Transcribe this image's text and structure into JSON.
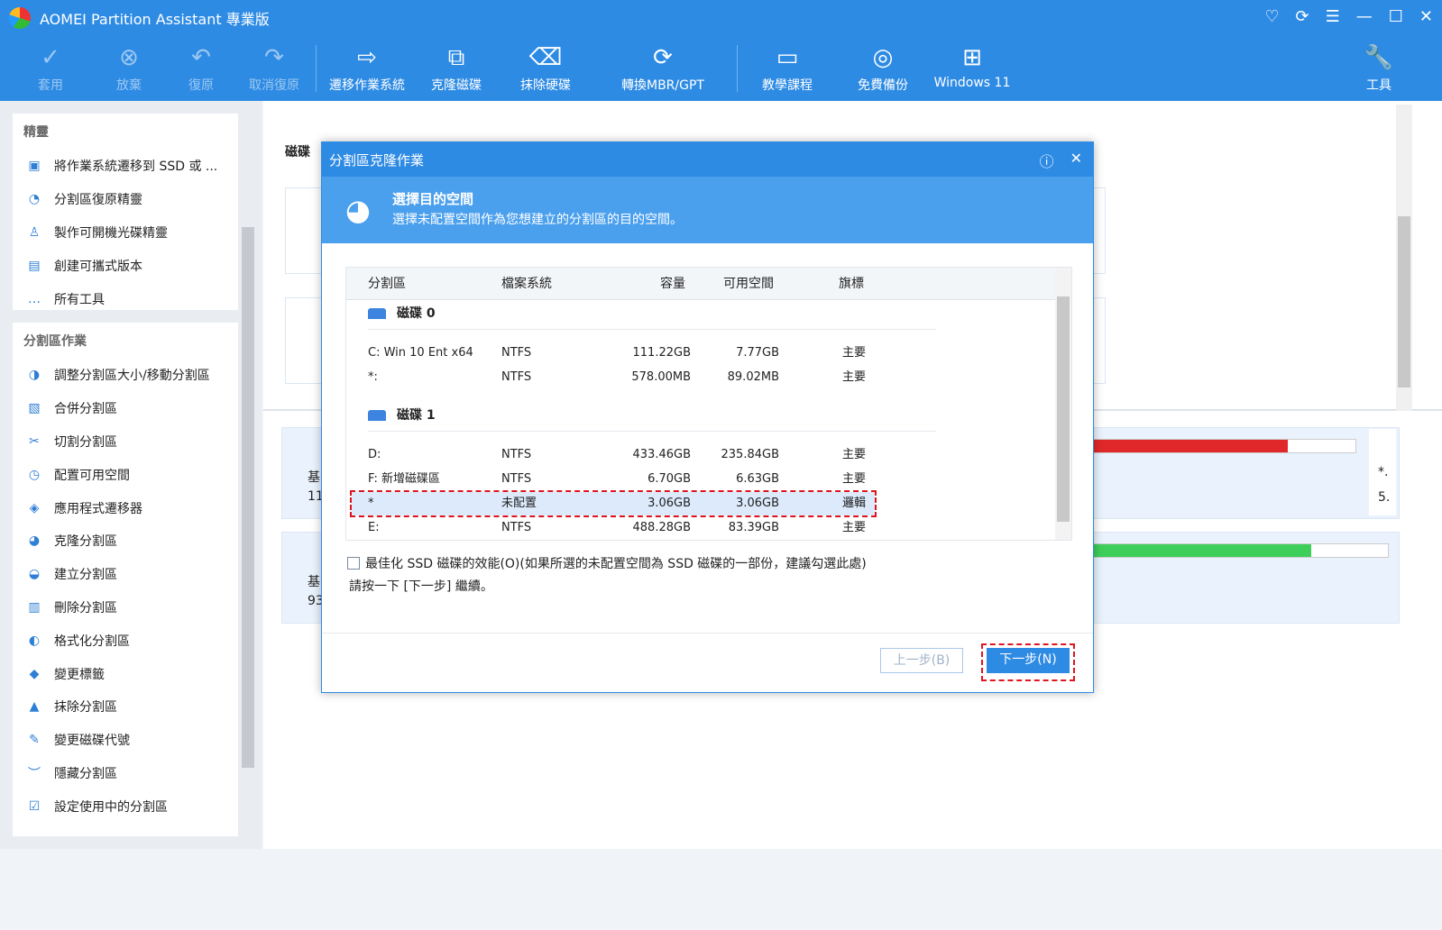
{
  "app": {
    "title": "AOMEI Partition Assistant 專業版"
  },
  "toolbar": [
    {
      "label": "套用",
      "icon": "✓",
      "disabled": true
    },
    {
      "label": "放棄",
      "icon": "⊗",
      "disabled": true
    },
    {
      "label": "復原",
      "icon": "↶",
      "disabled": true
    },
    {
      "label": "取消復原",
      "icon": "↷",
      "disabled": true
    },
    {
      "label": "遷移作業系統",
      "icon": "⇨"
    },
    {
      "label": "克隆磁碟",
      "icon": "⧉"
    },
    {
      "label": "抹除硬碟",
      "icon": "⌫"
    },
    {
      "label": "轉換MBR/GPT",
      "icon": "⟳"
    },
    {
      "label": "教學課程",
      "icon": "▭"
    },
    {
      "label": "免費備份",
      "icon": "◎"
    },
    {
      "label": "Windows 11",
      "icon": "⊞"
    },
    {
      "label": "工具",
      "icon": "🔧"
    }
  ],
  "sidebar": {
    "wizard_title": "精靈",
    "wizards": [
      "將作業系統遷移到 SSD 或 ...",
      "分割區復原精靈",
      "製作可開機光碟精靈",
      "創建可攜式版本",
      "所有工具"
    ],
    "ops_title": "分割區作業",
    "ops": [
      "調整分割區大小/移動分割區",
      "合併分割區",
      "切割分割區",
      "配置可用空間",
      "應用程式遷移器",
      "克隆分割區",
      "建立分割區",
      "刪除分割區",
      "格式化分割區",
      "變更標籤",
      "抹除分割區",
      "變更磁碟代號",
      "隱藏分割區",
      "設定使用中的分割區"
    ]
  },
  "main": {
    "heading": "磁碟",
    "partial": [
      "基",
      "11",
      "基",
      "93",
      "*.",
      "5."
    ]
  },
  "dialog": {
    "title": "分割區克隆作業",
    "step_title": "選擇目的空間",
    "step_desc": "選擇未配置空間作為您想建立的分割區的目的空間。",
    "columns": [
      "分割區",
      "檔案系統",
      "容量",
      "可用空間",
      "旗標"
    ],
    "disks": [
      {
        "name": "磁碟 0",
        "rows": [
          [
            "C:  Win 10 Ent x64",
            "NTFS",
            "111.22GB",
            "7.77GB",
            "主要"
          ],
          [
            "*:",
            "NTFS",
            "578.00MB",
            "89.02MB",
            "主要"
          ]
        ]
      },
      {
        "name": "磁碟 1",
        "rows": [
          [
            "D:",
            "NTFS",
            "433.46GB",
            "235.84GB",
            "主要"
          ],
          [
            "F:  新增磁碟區",
            "NTFS",
            "6.70GB",
            "6.63GB",
            "主要"
          ],
          [
            "*",
            "未配置",
            "3.06GB",
            "3.06GB",
            "邏輯"
          ],
          [
            "E:",
            "NTFS",
            "488.28GB",
            "83.39GB",
            "主要"
          ]
        ]
      }
    ],
    "checkbox_label": "最佳化 SSD 磁碟的效能(O)(如果所選的未配置空間為 SSD 磁碟的一部份，建議勾選此處)",
    "hint": "請按一下 [下一步] 繼續。",
    "back": "上一步(B)",
    "next": "下一步(N)"
  }
}
